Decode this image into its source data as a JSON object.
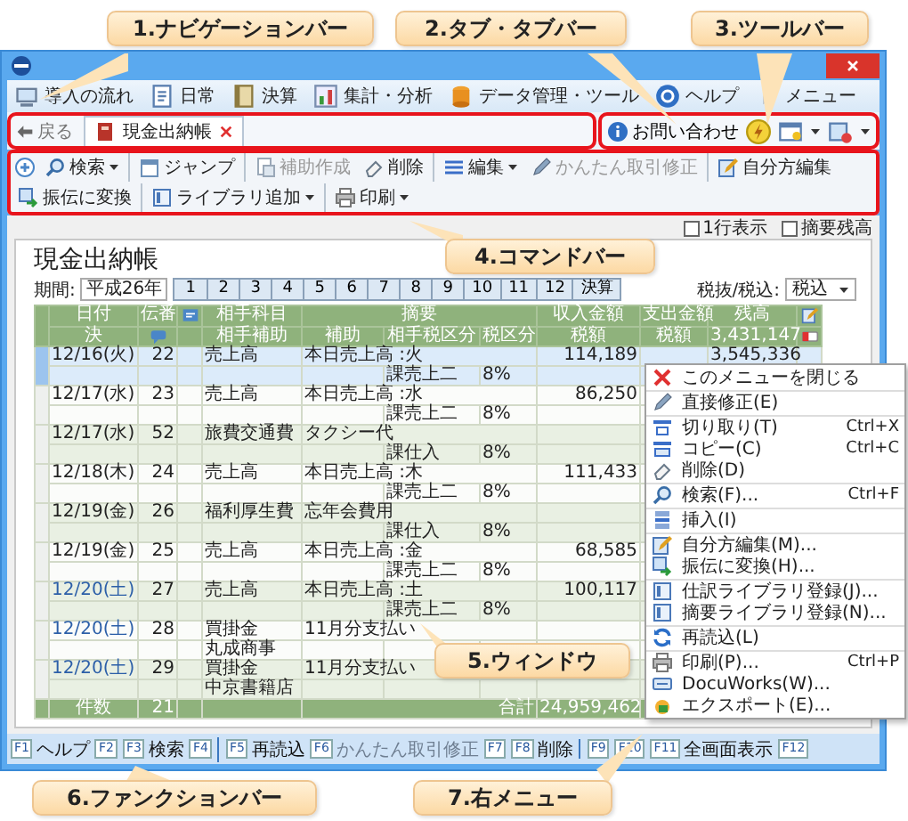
{
  "callouts": [
    {
      "label": "1.ナビゲーションバー"
    },
    {
      "label": "2.タブ・タブバー"
    },
    {
      "label": "3.ツールバー"
    },
    {
      "label": "4.コマンドバー"
    },
    {
      "label": "5.ウィンドウ"
    },
    {
      "label": "6.ファンクションバー"
    },
    {
      "label": "7.右メニュー"
    }
  ],
  "nav": [
    {
      "label": "導入の流れ"
    },
    {
      "label": "日常"
    },
    {
      "label": "決算"
    },
    {
      "label": "集計・分析"
    },
    {
      "label": "データ管理・ツール"
    },
    {
      "label": "ヘルプ"
    },
    {
      "label": "メニュー"
    }
  ],
  "tabbar": {
    "back": "戻る",
    "tabs": [
      {
        "label": "現金出納帳",
        "selected": true
      }
    ]
  },
  "toolbar": {
    "contact": "お問い合わせ"
  },
  "commands": [
    {
      "label": "検索",
      "dropdown": true,
      "disabled": false,
      "divider_before": false
    },
    {
      "label": "ジャンプ",
      "dropdown": false,
      "disabled": false,
      "divider_before": true
    },
    {
      "label": "補助作成",
      "dropdown": false,
      "disabled": true,
      "divider_before": true
    },
    {
      "label": "削除",
      "dropdown": false,
      "disabled": false,
      "divider_before": false
    },
    {
      "label": "編集",
      "dropdown": true,
      "disabled": false,
      "divider_before": true
    },
    {
      "label": "かんたん取引修正",
      "dropdown": false,
      "disabled": true,
      "divider_before": false
    },
    {
      "label": "自分方編集",
      "dropdown": false,
      "disabled": false,
      "divider_before": true
    },
    {
      "label": "振伝に変換",
      "dropdown": false,
      "disabled": false,
      "divider_before": false
    },
    {
      "label": "ライブラリ追加",
      "dropdown": true,
      "disabled": false,
      "divider_before": true
    },
    {
      "label": "印刷",
      "dropdown": true,
      "disabled": false,
      "divider_before": true
    }
  ],
  "options": [
    {
      "label": "1行表示",
      "checked": false
    },
    {
      "label": "摘要残高",
      "checked": false
    }
  ],
  "ledger": {
    "title": "現金出納帳",
    "period_label": "期間:",
    "period": "平成26年",
    "months": [
      {
        "label": "1",
        "selected": false
      },
      {
        "label": "2",
        "selected": false
      },
      {
        "label": "3",
        "selected": false
      },
      {
        "label": "4",
        "selected": false
      },
      {
        "label": "5",
        "selected": false
      },
      {
        "label": "6",
        "selected": false
      },
      {
        "label": "7",
        "selected": false
      },
      {
        "label": "8",
        "selected": false
      },
      {
        "label": "9",
        "selected": false
      },
      {
        "label": "10",
        "selected": false
      },
      {
        "label": "11",
        "selected": false
      },
      {
        "label": "12",
        "selected": false
      },
      {
        "label": "決算",
        "selected": false
      }
    ],
    "tax_label": "税抜/税込:",
    "tax_mode": "税込",
    "columns_top": [
      "日付",
      "伝番",
      "相手科目",
      "摘要",
      "収入金額",
      "支出金額",
      "残高"
    ],
    "columns_sub": [
      "決",
      "相手補助",
      "補助",
      "相手税区分",
      "税区分",
      "税額",
      "税額"
    ],
    "opening_balance": "3,431,147",
    "rows": [
      {
        "date": "12/16(火)",
        "no": "22",
        "account": "売上高",
        "memo": "本日売上高 :火",
        "income": "114,189",
        "balance": "3,545,336",
        "tax_class": "課売上二",
        "tax_rate": "8%",
        "weekend": false,
        "selected": true
      },
      {
        "date": "12/17(水)",
        "no": "23",
        "account": "売上高",
        "memo": "本日売上高 :水",
        "income": "86,250",
        "tax_class": "課売上二",
        "tax_rate": "8%",
        "weekend": false,
        "selected": false
      },
      {
        "date": "12/17(水)",
        "no": "52",
        "account": "旅費交通費",
        "memo": "タクシー代",
        "tax_class": "課仕入",
        "tax_rate": "8%",
        "weekend": false,
        "selected": false
      },
      {
        "date": "12/18(木)",
        "no": "24",
        "account": "売上高",
        "memo": "本日売上高 :木",
        "income": "111,433",
        "tax_class": "課売上二",
        "tax_rate": "8%",
        "weekend": false,
        "selected": false
      },
      {
        "date": "12/19(金)",
        "no": "26",
        "account": "福利厚生費",
        "memo": "忘年会費用",
        "tax_class": "課仕入",
        "tax_rate": "8%",
        "weekend": false,
        "selected": false
      },
      {
        "date": "12/19(金)",
        "no": "25",
        "account": "売上高",
        "memo": "本日売上高 :金",
        "income": "68,585",
        "tax_class": "課売上二",
        "tax_rate": "8%",
        "weekend": false,
        "selected": false
      },
      {
        "date": "12/20(土)",
        "no": "27",
        "account": "売上高",
        "memo": "本日売上高 :土",
        "income": "100,117",
        "tax_class": "課売上二",
        "tax_rate": "8%",
        "weekend": true,
        "selected": false
      },
      {
        "date": "12/20(土)",
        "no": "28",
        "account": "買掛金",
        "memo": "11月分支払い",
        "partner_sub": "丸成商事",
        "weekend": true,
        "selected": false
      },
      {
        "date": "12/20(土)",
        "no": "29",
        "account": "買掛金",
        "memo": "11月分支払い",
        "partner_sub": "中京書籍店",
        "weekend": true,
        "selected": false
      }
    ],
    "footer": {
      "count_label": "件数",
      "count": "21",
      "total_label": "合計",
      "total": "24,959,462"
    }
  },
  "function_keys": [
    {
      "key": "F1",
      "label": "ヘルプ",
      "disabled": false,
      "divider_before": false
    },
    {
      "key": "F2",
      "divider_before": false
    },
    {
      "key": "F3",
      "label": "検索",
      "disabled": false,
      "divider_before": false
    },
    {
      "key": "F4",
      "divider_before": false
    },
    {
      "key": "F5",
      "label": "再読込",
      "disabled": false,
      "divider_before": true
    },
    {
      "key": "F6",
      "label": "かんたん取引修正",
      "disabled": true,
      "divider_before": false
    },
    {
      "key": "F7",
      "divider_before": false
    },
    {
      "key": "F8",
      "label": "削除",
      "disabled": false,
      "divider_before": false
    },
    {
      "key": "F9",
      "divider_before": true
    },
    {
      "key": "F10",
      "divider_before": false
    },
    {
      "key": "F11",
      "label": "全画面表示",
      "disabled": false,
      "divider_before": false
    },
    {
      "key": "F12",
      "divider_before": false
    }
  ],
  "context_menu": [
    {
      "label": "このメニューを閉じる",
      "divider_before": false
    },
    {
      "label": "直接修正(E)",
      "divider_before": true
    },
    {
      "label": "切り取り(T)",
      "shortcut": "Ctrl+X",
      "divider_before": true
    },
    {
      "label": "コピー(C)",
      "shortcut": "Ctrl+C",
      "divider_before": false
    },
    {
      "label": "削除(D)",
      "divider_before": false
    },
    {
      "label": "検索(F)...",
      "shortcut": "Ctrl+F",
      "divider_before": true
    },
    {
      "label": "挿入(I)",
      "divider_before": true
    },
    {
      "label": "自分方編集(M)...",
      "divider_before": true
    },
    {
      "label": "振伝に変換(H)...",
      "divider_before": false
    },
    {
      "label": "仕訳ライブラリ登録(J)...",
      "divider_before": true
    },
    {
      "label": "摘要ライブラリ登録(N)...",
      "divider_before": false
    },
    {
      "label": "再読込(L)",
      "divider_before": true
    },
    {
      "label": "印刷(P)...",
      "shortcut": "Ctrl+P",
      "divider_before": true
    },
    {
      "label": "DocuWorks(W)...",
      "divider_before": false
    },
    {
      "label": "エクスポート(E)...",
      "divider_before": false
    }
  ]
}
